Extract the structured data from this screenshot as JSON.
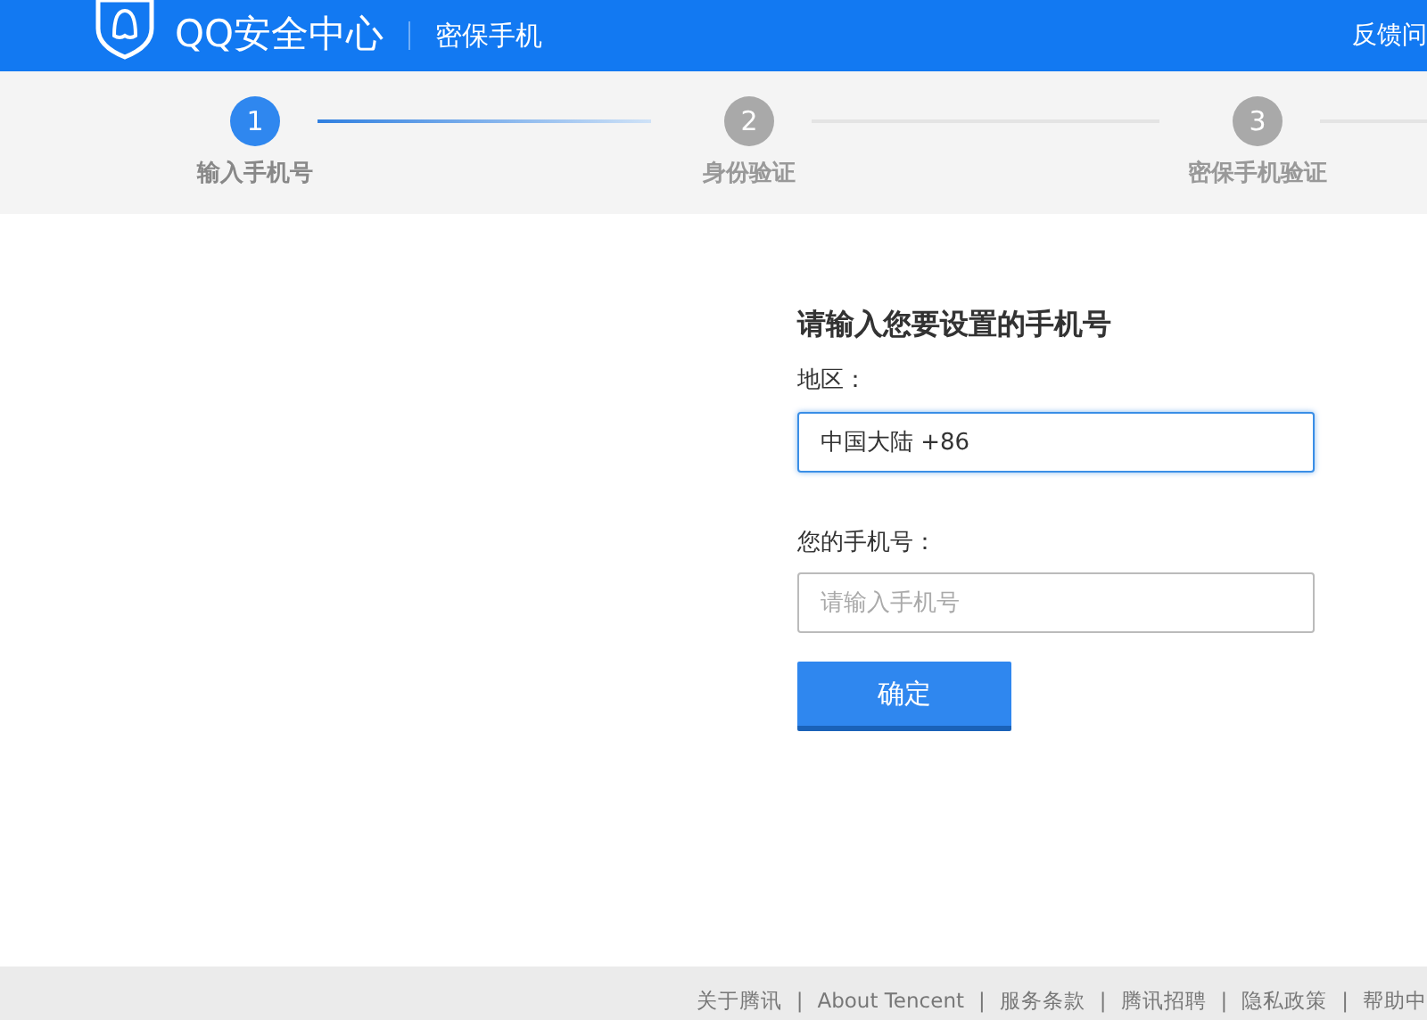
{
  "header": {
    "title": "QQ安全中心",
    "subtitle": "密保手机",
    "feedback_link": "反馈问"
  },
  "steps": [
    {
      "number": "1",
      "label": "输入手机号",
      "selected": true
    },
    {
      "number": "2",
      "label": "身份验证",
      "selected": false
    },
    {
      "number": "3",
      "label": "密保手机验证",
      "selected": false
    }
  ],
  "form": {
    "heading": "请输入您要设置的手机号",
    "fields": [
      {
        "label": "地区：",
        "value": "中国大陆 +86",
        "focused": true
      },
      {
        "label": "您的手机号：",
        "placeholder": "请输入手机号",
        "focused": false
      }
    ],
    "submit_button": "确定"
  },
  "footer": {
    "separator": "|",
    "links": [
      "关于腾讯",
      "About Tencent",
      "服务条款",
      "腾讯招聘",
      "隐私政策",
      "帮助中"
    ]
  }
}
